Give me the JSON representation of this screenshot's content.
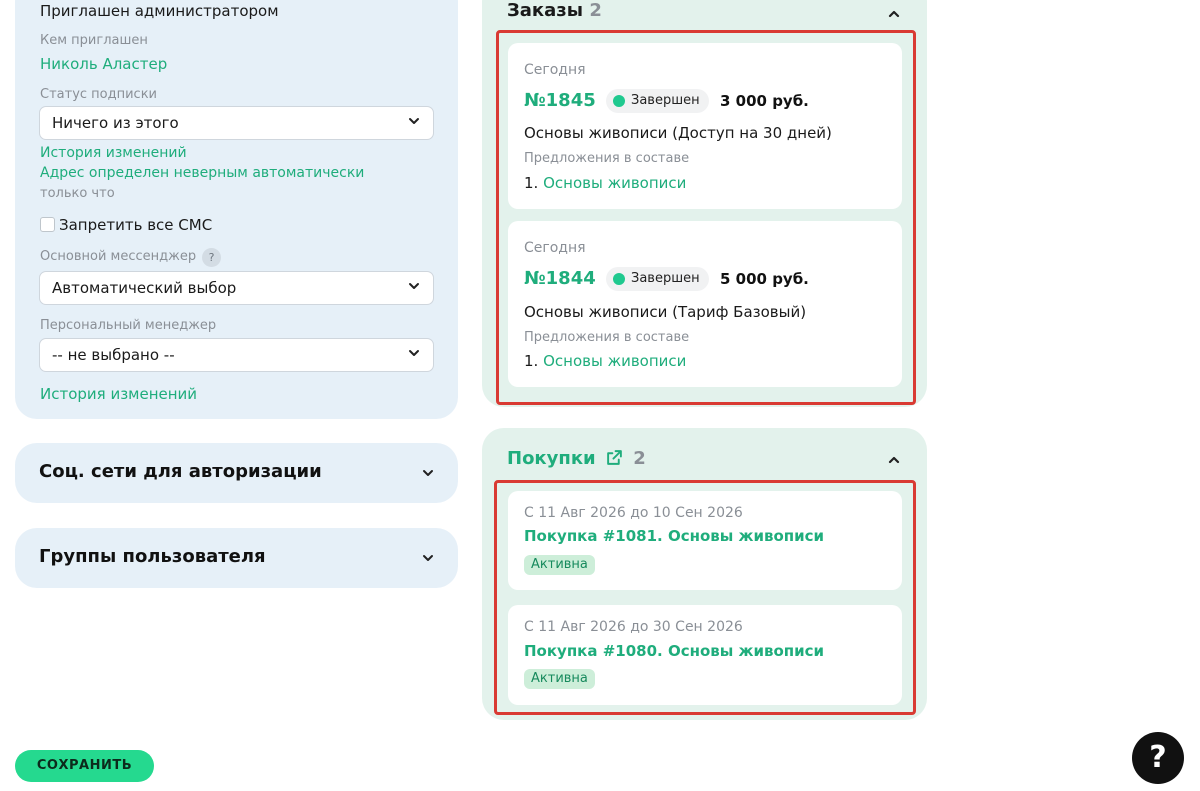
{
  "profile": {
    "invited_by_admin": "Приглашен администратором",
    "invited_by_label": "Кем приглашен",
    "invited_by_value": "Николь Аластер",
    "subscription_label": "Статус подписки",
    "subscription_value": "Ничего из этого",
    "history_link": "История изменений",
    "address_link": "Адрес определен неверным автоматически",
    "address_time": "только что",
    "block_sms_label": "Запретить все СМС",
    "block_sms_checked": false,
    "messenger_label": "Основной мессенджер",
    "messenger_help": "?",
    "messenger_value": "Автоматический выбор",
    "manager_label": "Персональный менеджер",
    "manager_value": "-- не выбрано --",
    "history_link_2": "История изменений"
  },
  "sections": {
    "social": "Соц. сети для авторизации",
    "groups": "Группы пользователя"
  },
  "orders": {
    "title": "Заказы",
    "count": "2",
    "items": [
      {
        "date": "Сегодня",
        "number": "№1845",
        "status": "Завершен",
        "price": "3 000 руб.",
        "product": "Основы живописи (Доступ на 30 дней)",
        "offers_label": "Предложения в составе",
        "offer_index": "1.",
        "offer_name": "Основы живописи"
      },
      {
        "date": "Сегодня",
        "number": "№1844",
        "status": "Завершен",
        "price": "5 000 руб.",
        "product": "Основы живописи (Тариф Базовый)",
        "offers_label": "Предложения в составе",
        "offer_index": "1.",
        "offer_name": "Основы живописи"
      }
    ]
  },
  "purchases": {
    "title": "Покупки",
    "count": "2",
    "items": [
      {
        "period": "С 11 Авг 2026 до 10 Сен 2026",
        "name": "Покупка #1081. Основы живописи",
        "status": "Активна"
      },
      {
        "period": "С 11 Авг 2026 до 30 Сен 2026",
        "name": "Покупка #1080. Основы живописи",
        "status": "Активна"
      }
    ]
  },
  "footer": {
    "save_label": "СОХРАНИТЬ",
    "help_label": "?"
  },
  "colors": {
    "accent": "#1fad7c",
    "save_button": "#25d98f",
    "highlight_frame": "#d93a33",
    "left_panel_bg": "#e6f0f8",
    "right_panel_bg": "#e3f2ec"
  },
  "icons": [
    "chevron-down-icon",
    "chevron-up-icon",
    "external-link-icon",
    "help-icon",
    "status-dot-icon"
  ]
}
